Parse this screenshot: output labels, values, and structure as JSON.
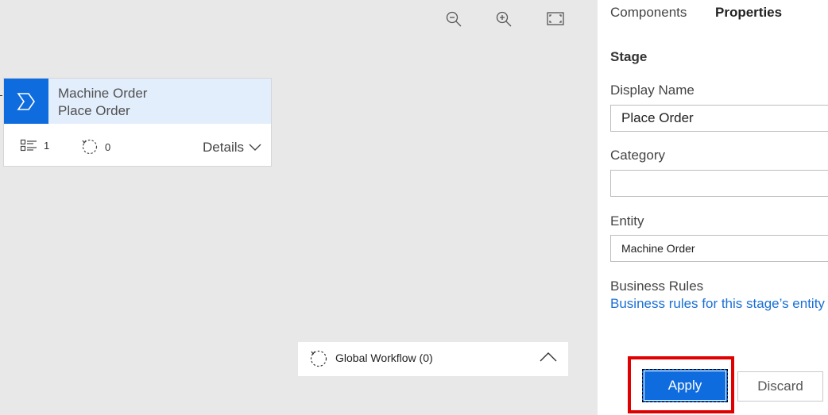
{
  "toolbar": {
    "zoom_out_icon": "zoom-out-icon",
    "zoom_in_icon": "zoom-in-icon",
    "fit_icon": "fit-to-screen-icon"
  },
  "stage_card": {
    "entity": "Machine Order",
    "name": "Place Order",
    "steps_count": "1",
    "workflows_count": "0",
    "details_label": "Details",
    "accent_color": "#0f6cde",
    "header_bg": "#e3eefc"
  },
  "global_workflow": {
    "label": "Global Workflow (0)"
  },
  "panel": {
    "tabs": [
      {
        "label": "Components",
        "active": false
      },
      {
        "label": "Properties",
        "active": true
      }
    ],
    "section_title": "Stage",
    "display_name": {
      "label": "Display Name",
      "value": "Place Order"
    },
    "category": {
      "label": "Category",
      "value": ""
    },
    "entity": {
      "label": "Entity",
      "value": "Machine Order"
    },
    "business_rules": {
      "label": "Business Rules",
      "link": "Business rules for this stage’s entity"
    },
    "apply_label": "Apply",
    "discard_label": "Discard",
    "highlight_color": "#e00000"
  }
}
